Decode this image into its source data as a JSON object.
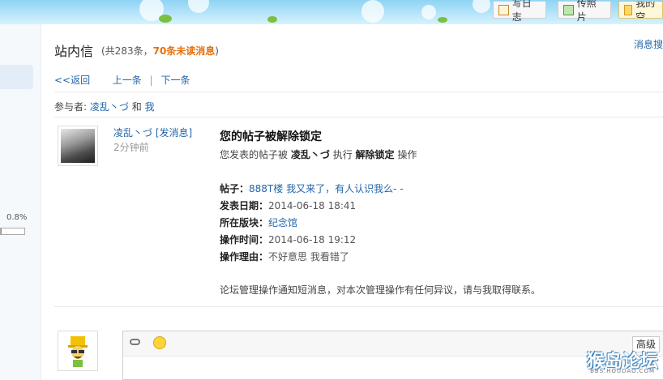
{
  "topbar": {
    "write_blog": "写日志",
    "upload_photo": "传照片",
    "my_space": "我的空"
  },
  "sidebar": {
    "usage_percent": "0.8%",
    "usage_value": 0.008
  },
  "header": {
    "title": "站内信",
    "meta_prefix": "(共283条，",
    "unread": "70条未读消息",
    "meta_suffix": ")",
    "search_link": "消息搜"
  },
  "nav": {
    "back": "<<返回",
    "prev": "上一条",
    "separator": "|",
    "next": "下一条"
  },
  "participants": {
    "label": "参与者:",
    "user": "凌乱丶づ",
    "and": "和",
    "me": "我"
  },
  "message": {
    "sender": "凌乱丶づ",
    "send_link": "[发消息]",
    "time_ago": "2分钟前",
    "title": "您的帖子被解除锁定",
    "desc_prefix": "您发表的帖子被",
    "desc_user": "凌乱丶づ",
    "desc_exec": "执行",
    "desc_action": "解除锁定",
    "desc_suffix": "操作",
    "post_label": "帖子：",
    "post_value": "888T楼 我又来了，有人认识我么- -",
    "date_label": "发表日期：",
    "date_value": "2014-06-18 18:41",
    "board_label": "所在版块：",
    "board_value": "纪念馆",
    "optime_label": "操作时间：",
    "optime_value": "2014-06-18 19:12",
    "reason_label": "操作理由：",
    "reason_value": "不好意思 我看错了",
    "footer": "论坛管理操作通知短消息，对本次管理操作有任何异议，请与我取得联系。"
  },
  "reply": {
    "advanced": "高级"
  },
  "watermark": {
    "text": "猴岛论坛",
    "sub": "BBS.HOUDAO.COM"
  },
  "colors": {
    "link": "#2266aa",
    "unread": "#e6700d",
    "banner": "#b9e6fb"
  }
}
